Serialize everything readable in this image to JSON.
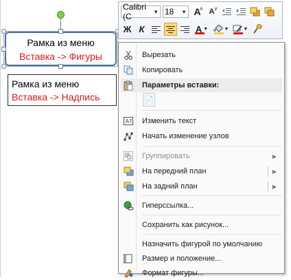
{
  "shapes": {
    "shape1": {
      "line1": "Рамка из меню",
      "line2": "Вставка -> Фигуры"
    },
    "shape2": {
      "line1": "Рамка из меню",
      "line2": "Вставка -> Надпись"
    }
  },
  "toolbar": {
    "font_name": "Calibri (С",
    "font_size": "18",
    "grow_font": "A",
    "shrink_font": "A",
    "bold": "Ж",
    "italic": "К",
    "font_color_letter": "A",
    "colors": {
      "font": "#e01b1b",
      "fill": "#f0d040",
      "outline": "#e01b1b"
    }
  },
  "menu": {
    "cut": "Вырезать",
    "copy": "Копировать",
    "paste_options": "Параметры вставки:",
    "edit_text": "Изменить текст",
    "edit_points": "Начать изменение узлов",
    "group": "Группировать",
    "bring_front": "На передний план",
    "send_back": "На задний план",
    "hyperlink": "Гиперссылка...",
    "save_as_picture": "Сохранить как рисунок...",
    "set_default": "Назначить фигурой по умолчанию",
    "size_position": "Размер и положение...",
    "format_shape": "Формат фигуры..."
  }
}
